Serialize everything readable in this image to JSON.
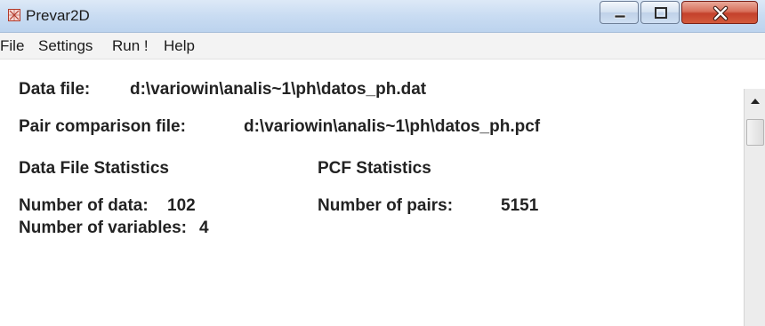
{
  "window": {
    "title": "Prevar2D",
    "app_icon": "prevar-window-icon",
    "controls": {
      "minimize_icon": "minimize-icon",
      "maximize_icon": "maximize-icon",
      "close_icon": "close-icon",
      "close_color": "#c4412b"
    }
  },
  "menu": {
    "items": [
      {
        "label": "File"
      },
      {
        "label": "Settings"
      },
      {
        "label": "Run !"
      },
      {
        "label": "Help"
      }
    ]
  },
  "main": {
    "data_file_label": "Data file:",
    "data_file_path": "d:\\variowin\\analis~1\\ph\\datos_ph.dat",
    "pcf_label": "Pair comparison file:",
    "pcf_path": "d:\\variowin\\analis~1\\ph\\datos_ph.pcf",
    "data_stats": {
      "heading": "Data File Statistics",
      "num_data_label": "Number of data:",
      "num_data_value": "102",
      "num_vars_label": "Number of variables:",
      "num_vars_value": "4"
    },
    "pcf_stats": {
      "heading": "PCF Statistics",
      "num_pairs_label": "Number of pairs:",
      "num_pairs_value": "5151"
    }
  },
  "scrollbar": {
    "up_icon": "scroll-up-arrow-icon"
  }
}
